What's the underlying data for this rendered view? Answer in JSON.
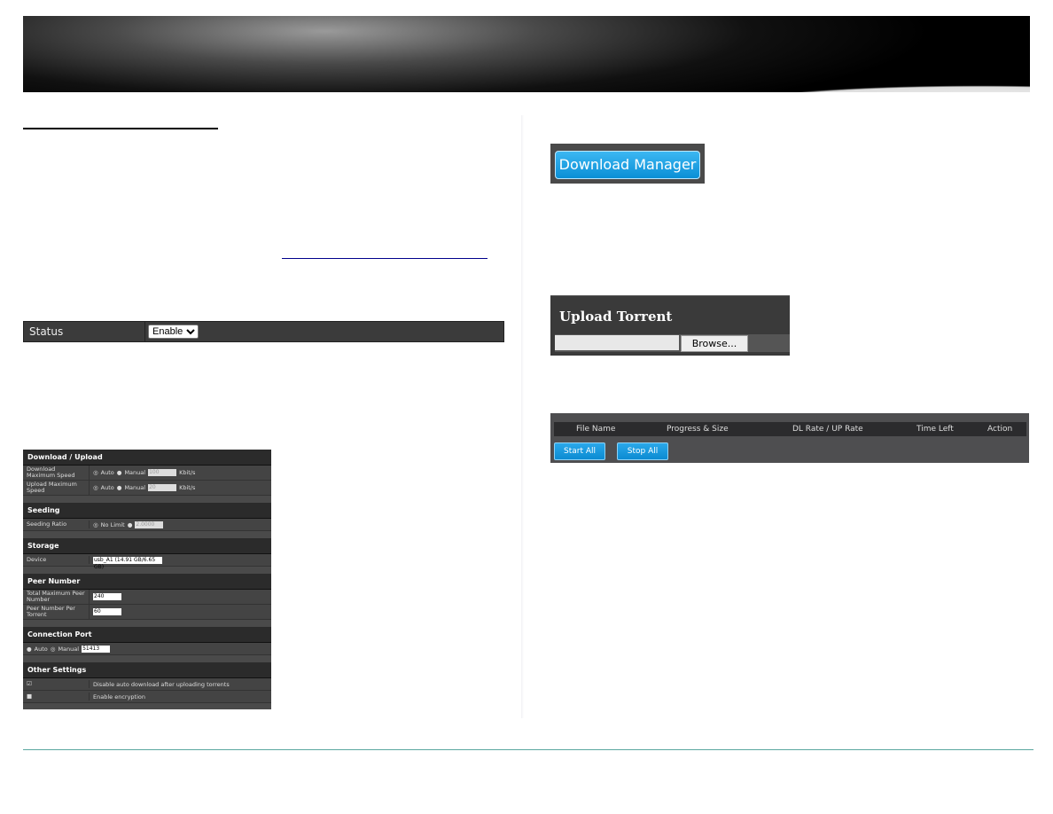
{
  "status_panel": {
    "label": "Status",
    "value": "Enable"
  },
  "settings": {
    "download_upload": {
      "title": "Download / Upload",
      "download_label": "Download Maximum Speed",
      "upload_label": "Upload Maximum Speed",
      "auto": "Auto",
      "manual": "Manual",
      "download_value": "100",
      "upload_value": "20",
      "unit": "Kbit/s"
    },
    "seeding": {
      "title": "Seeding",
      "label": "Seeding Ratio",
      "no_limit": "No Limit",
      "value": "2.0000"
    },
    "storage": {
      "title": "Storage",
      "label": "Device",
      "value": "usb_A1 (14.91 GB/6.65 GB)"
    },
    "peer": {
      "title": "Peer Number",
      "total_label": "Total Maximum Peer Number",
      "total_value": "240",
      "per_label": "Peer Number Per Torrent",
      "per_value": "60"
    },
    "port": {
      "title": "Connection Port",
      "auto": "Auto",
      "manual": "Manual",
      "value": "51413"
    },
    "other": {
      "title": "Other Settings",
      "opt1": "Disable auto download after uploading torrents",
      "opt1_checked": true,
      "opt2": "Enable encryption",
      "opt2_checked": false
    }
  },
  "download_manager": {
    "label": "Download Manager"
  },
  "upload_torrent": {
    "title": "Upload Torrent",
    "browse": "Browse..."
  },
  "torrent_table": {
    "columns": [
      "File Name",
      "Progress & Size",
      "DL Rate / UP Rate",
      "Time Left",
      "Action"
    ],
    "start_all": "Start All",
    "stop_all": "Stop All"
  }
}
